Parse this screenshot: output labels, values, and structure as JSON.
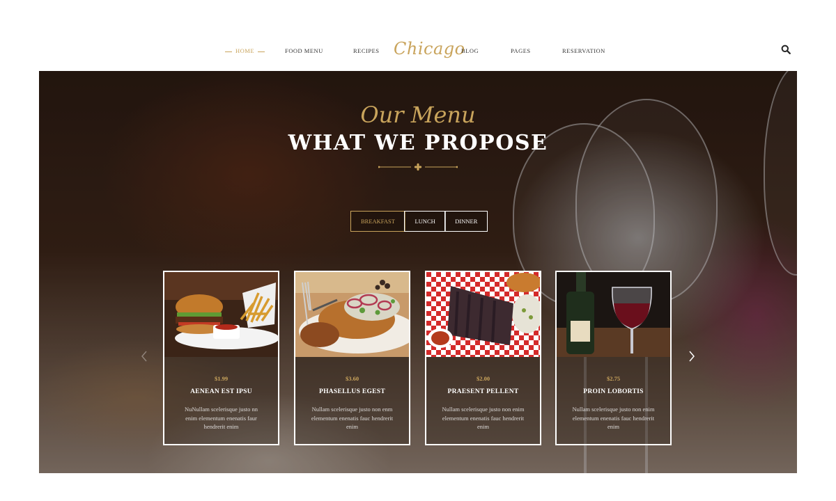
{
  "nav": {
    "left": [
      "HOME",
      "FOOD MENU",
      "RECIPES"
    ],
    "logo": "Chicago",
    "right": [
      "BLOG",
      "PAGES",
      "RESERVATION"
    ]
  },
  "hero": {
    "script_title": "Our Menu",
    "title": "WHAT WE PROPOSE",
    "tabs": [
      "BREAKFAST",
      "LUNCH",
      "DINNER"
    ],
    "active_tab": "BREAKFAST"
  },
  "cards": [
    {
      "price": "$1.99",
      "name": "AENEAN EST IPSU",
      "desc": "NuNullam scelerisque justo nn enim elementum enenatis faur hendrerit enim"
    },
    {
      "price": "$3.60",
      "name": "PHASELLUS EGEST",
      "desc": "Nullam scelerisque justo non enm elementum enenatis fauc hendrerit enim"
    },
    {
      "price": "$2.00",
      "name": "PRAESENT PELLENT",
      "desc": "Nullam scelerisque justo non enim elementum enenatis fauc hendrerit enim"
    },
    {
      "price": "$2.75",
      "name": "PROIN LOBORTIS",
      "desc": "Nullam scelerisque justo non enim elementum enenatis fauc hendrerit enim"
    }
  ],
  "colors": {
    "accent": "#c9a45c",
    "text": "#333333",
    "white": "#ffffff"
  },
  "icons": [
    "search-icon",
    "flower-ornament-icon",
    "chevron-left-icon",
    "chevron-right-icon"
  ]
}
